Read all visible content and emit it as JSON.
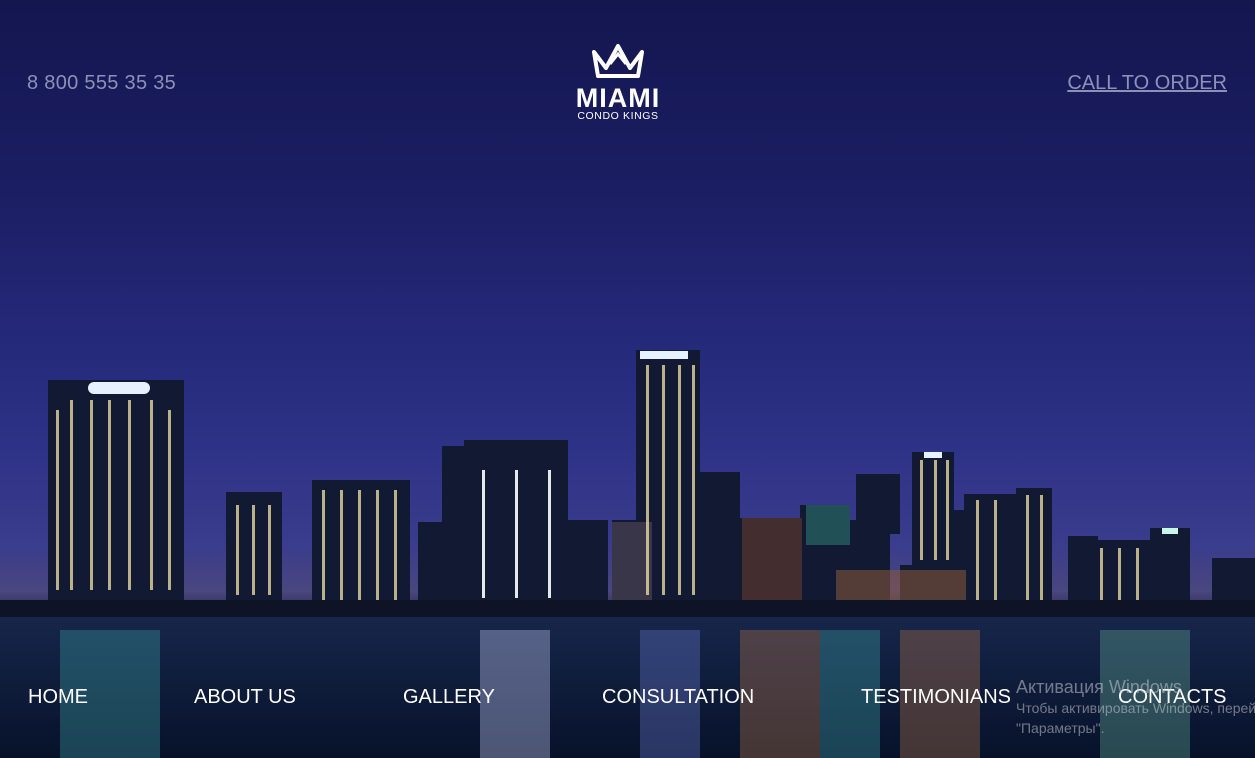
{
  "header": {
    "phone": "8 800 555 35 35",
    "cta_label": "CALL TO ORDER"
  },
  "logo": {
    "word": "MIAMI",
    "tagline": "CONDO KINGS",
    "icon": "crown-icon"
  },
  "nav": {
    "items": [
      {
        "label": "HOME"
      },
      {
        "label": "ABOUT US"
      },
      {
        "label": "GALLERY"
      },
      {
        "label": "CONSULTATION"
      },
      {
        "label": "TESTIMONIANS"
      },
      {
        "label": "CONTACTS"
      }
    ]
  },
  "os_watermark": {
    "title": "Активация Windows",
    "line1": "Чтобы активировать Windows, перейдите в раздел",
    "line2": "\"Параметры\"."
  },
  "colors": {
    "sky_top": "#141650",
    "sky_horizon": "#3a3c8c",
    "water": "#0b1830",
    "header_text": "#8d91b8",
    "nav_text": "#ffffff"
  }
}
